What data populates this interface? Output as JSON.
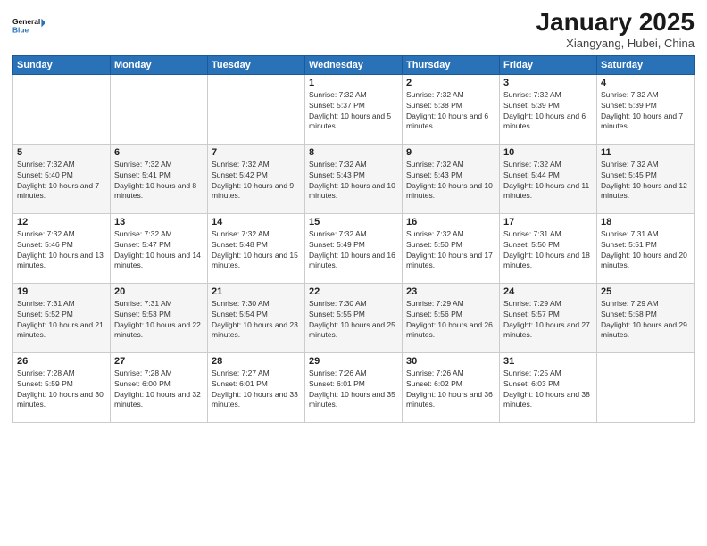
{
  "logo": {
    "line1": "General",
    "line2": "Blue"
  },
  "title": "January 2025",
  "location": "Xiangyang, Hubei, China",
  "weekdays": [
    "Sunday",
    "Monday",
    "Tuesday",
    "Wednesday",
    "Thursday",
    "Friday",
    "Saturday"
  ],
  "weeks": [
    [
      {
        "day": "",
        "sunrise": "",
        "sunset": "",
        "daylight": ""
      },
      {
        "day": "",
        "sunrise": "",
        "sunset": "",
        "daylight": ""
      },
      {
        "day": "",
        "sunrise": "",
        "sunset": "",
        "daylight": ""
      },
      {
        "day": "1",
        "sunrise": "Sunrise: 7:32 AM",
        "sunset": "Sunset: 5:37 PM",
        "daylight": "Daylight: 10 hours and 5 minutes."
      },
      {
        "day": "2",
        "sunrise": "Sunrise: 7:32 AM",
        "sunset": "Sunset: 5:38 PM",
        "daylight": "Daylight: 10 hours and 6 minutes."
      },
      {
        "day": "3",
        "sunrise": "Sunrise: 7:32 AM",
        "sunset": "Sunset: 5:39 PM",
        "daylight": "Daylight: 10 hours and 6 minutes."
      },
      {
        "day": "4",
        "sunrise": "Sunrise: 7:32 AM",
        "sunset": "Sunset: 5:39 PM",
        "daylight": "Daylight: 10 hours and 7 minutes."
      }
    ],
    [
      {
        "day": "5",
        "sunrise": "Sunrise: 7:32 AM",
        "sunset": "Sunset: 5:40 PM",
        "daylight": "Daylight: 10 hours and 7 minutes."
      },
      {
        "day": "6",
        "sunrise": "Sunrise: 7:32 AM",
        "sunset": "Sunset: 5:41 PM",
        "daylight": "Daylight: 10 hours and 8 minutes."
      },
      {
        "day": "7",
        "sunrise": "Sunrise: 7:32 AM",
        "sunset": "Sunset: 5:42 PM",
        "daylight": "Daylight: 10 hours and 9 minutes."
      },
      {
        "day": "8",
        "sunrise": "Sunrise: 7:32 AM",
        "sunset": "Sunset: 5:43 PM",
        "daylight": "Daylight: 10 hours and 10 minutes."
      },
      {
        "day": "9",
        "sunrise": "Sunrise: 7:32 AM",
        "sunset": "Sunset: 5:43 PM",
        "daylight": "Daylight: 10 hours and 10 minutes."
      },
      {
        "day": "10",
        "sunrise": "Sunrise: 7:32 AM",
        "sunset": "Sunset: 5:44 PM",
        "daylight": "Daylight: 10 hours and 11 minutes."
      },
      {
        "day": "11",
        "sunrise": "Sunrise: 7:32 AM",
        "sunset": "Sunset: 5:45 PM",
        "daylight": "Daylight: 10 hours and 12 minutes."
      }
    ],
    [
      {
        "day": "12",
        "sunrise": "Sunrise: 7:32 AM",
        "sunset": "Sunset: 5:46 PM",
        "daylight": "Daylight: 10 hours and 13 minutes."
      },
      {
        "day": "13",
        "sunrise": "Sunrise: 7:32 AM",
        "sunset": "Sunset: 5:47 PM",
        "daylight": "Daylight: 10 hours and 14 minutes."
      },
      {
        "day": "14",
        "sunrise": "Sunrise: 7:32 AM",
        "sunset": "Sunset: 5:48 PM",
        "daylight": "Daylight: 10 hours and 15 minutes."
      },
      {
        "day": "15",
        "sunrise": "Sunrise: 7:32 AM",
        "sunset": "Sunset: 5:49 PM",
        "daylight": "Daylight: 10 hours and 16 minutes."
      },
      {
        "day": "16",
        "sunrise": "Sunrise: 7:32 AM",
        "sunset": "Sunset: 5:50 PM",
        "daylight": "Daylight: 10 hours and 17 minutes."
      },
      {
        "day": "17",
        "sunrise": "Sunrise: 7:31 AM",
        "sunset": "Sunset: 5:50 PM",
        "daylight": "Daylight: 10 hours and 18 minutes."
      },
      {
        "day": "18",
        "sunrise": "Sunrise: 7:31 AM",
        "sunset": "Sunset: 5:51 PM",
        "daylight": "Daylight: 10 hours and 20 minutes."
      }
    ],
    [
      {
        "day": "19",
        "sunrise": "Sunrise: 7:31 AM",
        "sunset": "Sunset: 5:52 PM",
        "daylight": "Daylight: 10 hours and 21 minutes."
      },
      {
        "day": "20",
        "sunrise": "Sunrise: 7:31 AM",
        "sunset": "Sunset: 5:53 PM",
        "daylight": "Daylight: 10 hours and 22 minutes."
      },
      {
        "day": "21",
        "sunrise": "Sunrise: 7:30 AM",
        "sunset": "Sunset: 5:54 PM",
        "daylight": "Daylight: 10 hours and 23 minutes."
      },
      {
        "day": "22",
        "sunrise": "Sunrise: 7:30 AM",
        "sunset": "Sunset: 5:55 PM",
        "daylight": "Daylight: 10 hours and 25 minutes."
      },
      {
        "day": "23",
        "sunrise": "Sunrise: 7:29 AM",
        "sunset": "Sunset: 5:56 PM",
        "daylight": "Daylight: 10 hours and 26 minutes."
      },
      {
        "day": "24",
        "sunrise": "Sunrise: 7:29 AM",
        "sunset": "Sunset: 5:57 PM",
        "daylight": "Daylight: 10 hours and 27 minutes."
      },
      {
        "day": "25",
        "sunrise": "Sunrise: 7:29 AM",
        "sunset": "Sunset: 5:58 PM",
        "daylight": "Daylight: 10 hours and 29 minutes."
      }
    ],
    [
      {
        "day": "26",
        "sunrise": "Sunrise: 7:28 AM",
        "sunset": "Sunset: 5:59 PM",
        "daylight": "Daylight: 10 hours and 30 minutes."
      },
      {
        "day": "27",
        "sunrise": "Sunrise: 7:28 AM",
        "sunset": "Sunset: 6:00 PM",
        "daylight": "Daylight: 10 hours and 32 minutes."
      },
      {
        "day": "28",
        "sunrise": "Sunrise: 7:27 AM",
        "sunset": "Sunset: 6:01 PM",
        "daylight": "Daylight: 10 hours and 33 minutes."
      },
      {
        "day": "29",
        "sunrise": "Sunrise: 7:26 AM",
        "sunset": "Sunset: 6:01 PM",
        "daylight": "Daylight: 10 hours and 35 minutes."
      },
      {
        "day": "30",
        "sunrise": "Sunrise: 7:26 AM",
        "sunset": "Sunset: 6:02 PM",
        "daylight": "Daylight: 10 hours and 36 minutes."
      },
      {
        "day": "31",
        "sunrise": "Sunrise: 7:25 AM",
        "sunset": "Sunset: 6:03 PM",
        "daylight": "Daylight: 10 hours and 38 minutes."
      },
      {
        "day": "",
        "sunrise": "",
        "sunset": "",
        "daylight": ""
      }
    ]
  ]
}
